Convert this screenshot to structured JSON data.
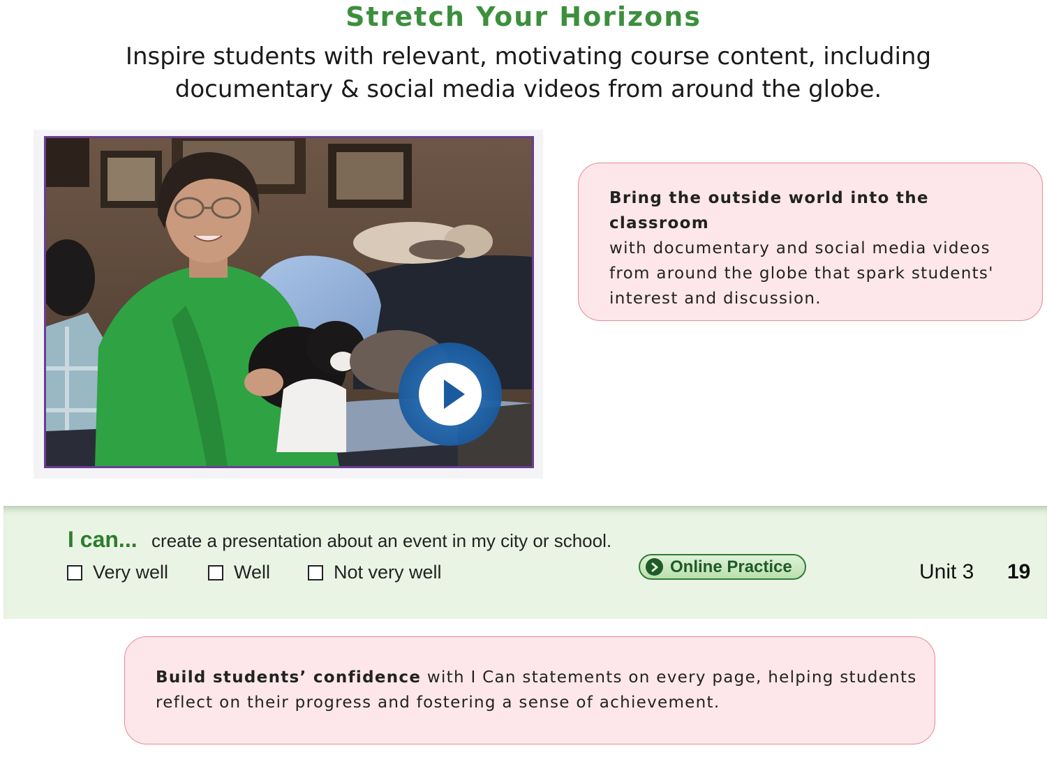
{
  "header": {
    "title": "Stretch Your Horizons",
    "subtitle_line1": "Inspire students with relevant, motivating course content, including",
    "subtitle_line2": "documentary & social media videos from around the globe."
  },
  "video": {
    "play_icon": "play-icon",
    "frame_color": "#6a3d94"
  },
  "callout_video": {
    "bold": "Bring the outside world into the classroom",
    "text": "with documentary and social media videos from around the globe that spark students' interest and discussion."
  },
  "ican": {
    "label": "I can...",
    "statement": "create a presentation about an event in my city or school.",
    "ratings": [
      "Very well",
      "Well",
      "Not very well"
    ],
    "online_practice": "Online Practice",
    "unit": "Unit 3",
    "page": "19"
  },
  "callout_confidence": {
    "bold": "Build students’ confidence",
    "text": "with I Can statements on every page, helping students reflect on their progress and fostering a sense of achievement."
  },
  "colors": {
    "title_green": "#3c8f3c",
    "callout_bg": "#fde7ea",
    "callout_border": "#e58a96",
    "strip_bg": "#eaf4e4",
    "ican_green": "#2d7d2d"
  }
}
